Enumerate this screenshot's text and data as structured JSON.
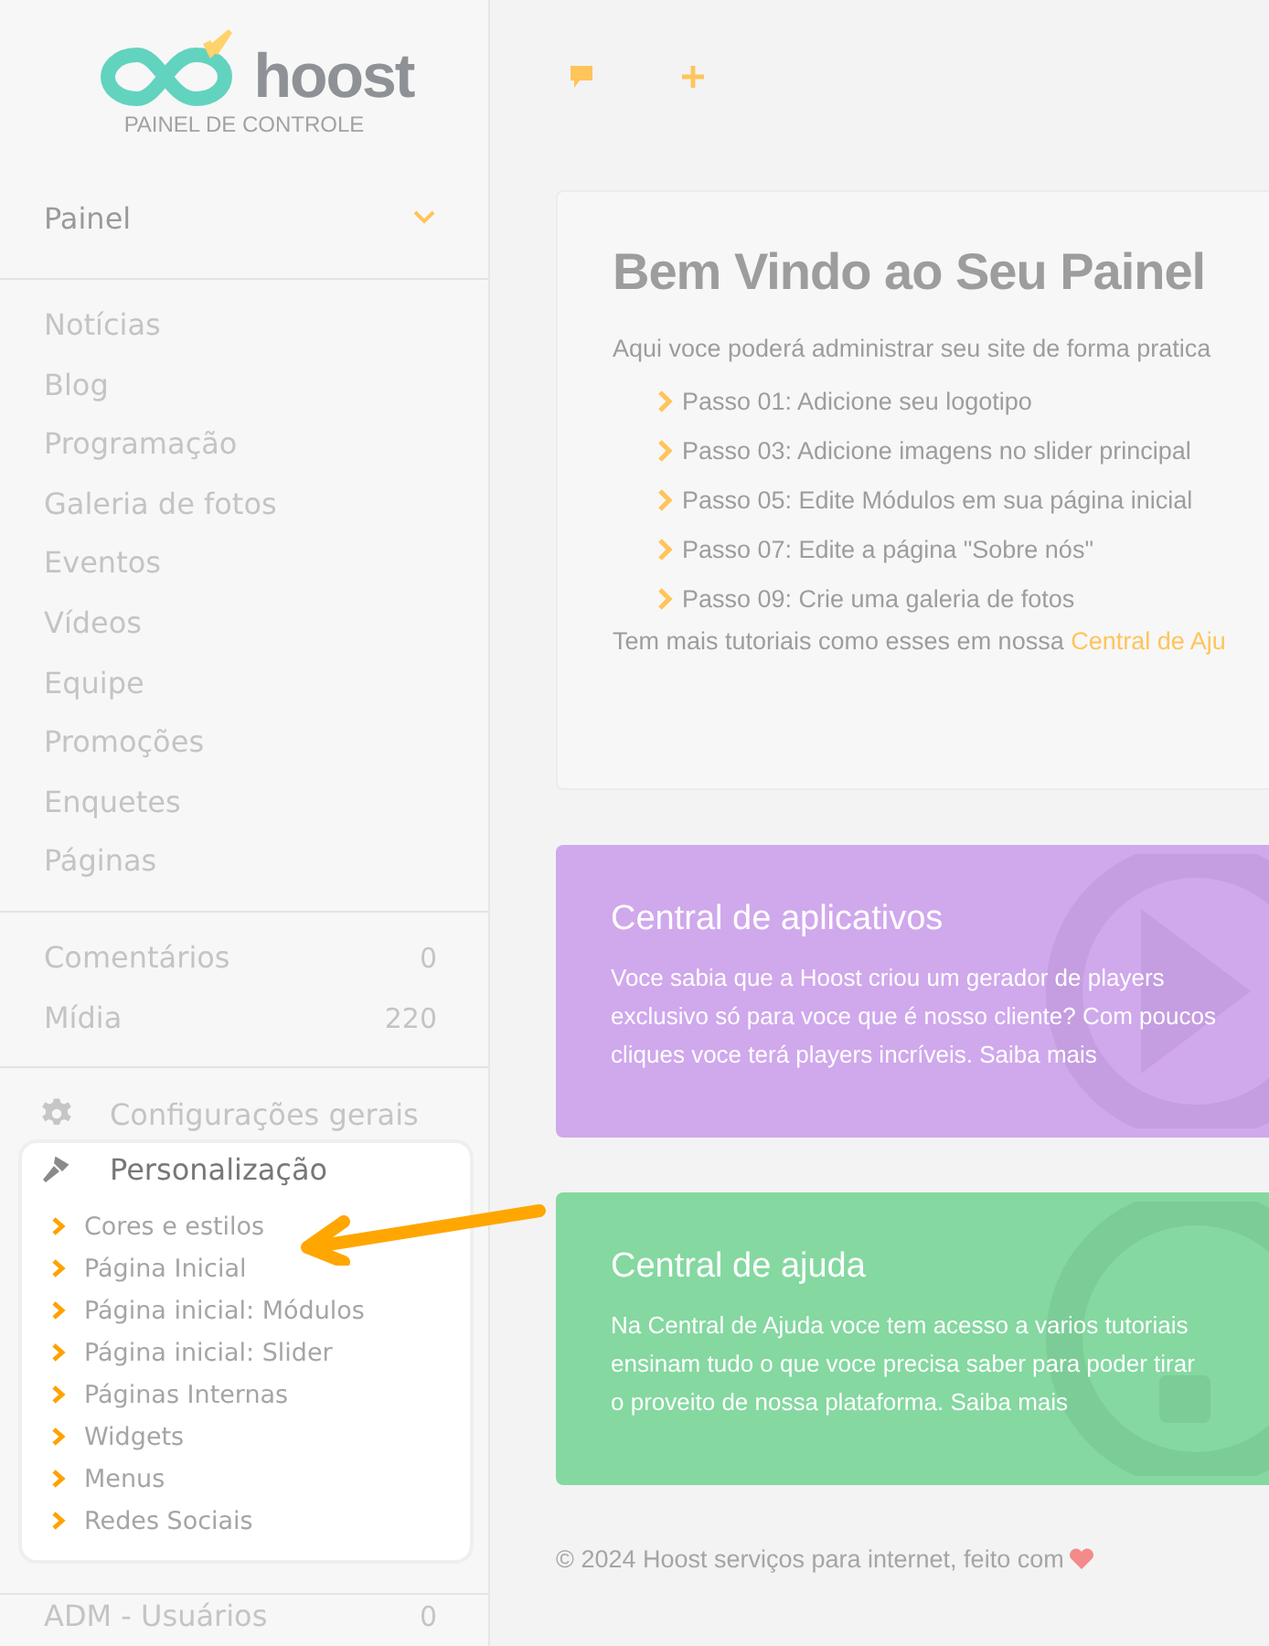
{
  "logo": {
    "brand": "hoost",
    "subtitle": "PAINEL DE CONTROLE"
  },
  "sidebar": {
    "header": {
      "label": "Painel",
      "expanded": true
    },
    "items": [
      "Notícias",
      "Blog",
      "Programação",
      "Galeria de fotos",
      "Eventos",
      "Vídeos",
      "Equipe",
      "Promoções",
      "Enquetes",
      "Páginas"
    ],
    "counts": [
      {
        "label": "Comentários",
        "count": "0"
      },
      {
        "label": "Mídia",
        "count": "220"
      }
    ],
    "settings": [
      {
        "label": "Configurações gerais",
        "kind": "gear",
        "expanded": false
      },
      {
        "label": "Personalização",
        "kind": "brush",
        "expanded": true,
        "children": [
          "Cores e estilos",
          "Página Inicial",
          "Página inicial: Módulos",
          "Página inicial: Slider",
          "Páginas Internas",
          "Widgets",
          "Menus",
          "Redes Sociais"
        ]
      }
    ],
    "footer_item": {
      "label": "ADM - Usuários",
      "count": "0"
    }
  },
  "welcome": {
    "title": "Bem Vindo ao Seu Painel",
    "intro": "Aqui voce poderá administrar seu site de forma pratica",
    "steps": [
      "Passo 01: Adicione seu logotipo",
      "Passo 03: Adicione imagens no slider principal",
      "Passo 05: Edite Módulos em sua página inicial",
      "Passo 07: Edite a página \"Sobre nós\"",
      "Passo 09: Crie uma galeria de fotos"
    ],
    "more_text": "Tem mais tutoriais como esses em nossa",
    "more_link": "Central de Aju"
  },
  "cards": [
    {
      "kind": "play",
      "color": "#d0a8ec",
      "title": "Central de aplicativos",
      "lines": [
        "Voce sabia que a Hoost criou um gerador de players",
        "exclusivo só para voce que é nosso cliente? Com poucos",
        "cliques voce terá players incríveis. Saiba mais"
      ]
    },
    {
      "kind": "help",
      "color": "#84d8a0",
      "title": "Central de ajuda",
      "lines": [
        "Na Central de Ajuda voce tem acesso a varios tutoriais",
        "ensinam tudo o que voce precisa saber para poder tirar",
        "o proveito de nossa plataforma. Saiba mais"
      ]
    }
  ],
  "footer": "© 2024 Hoost serviços para internet, feito com"
}
